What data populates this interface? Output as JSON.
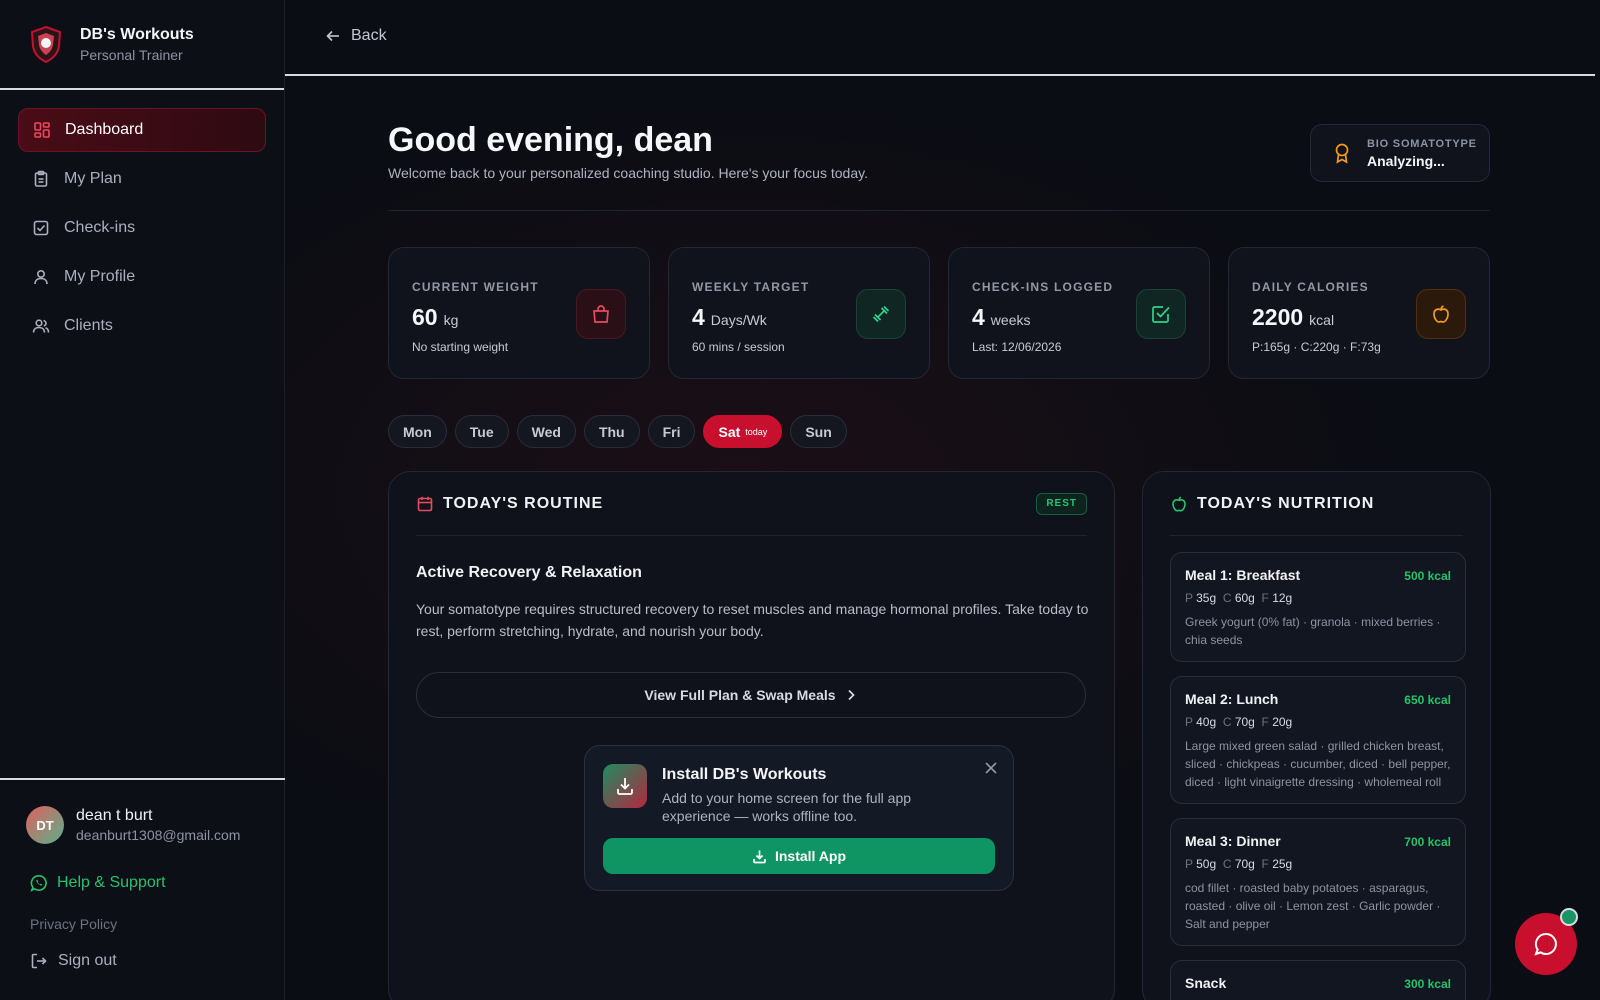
{
  "brand": {
    "title": "DB's Workouts",
    "subtitle": "Personal Trainer",
    "logo_icon": "shield-logo-icon"
  },
  "nav": {
    "items": [
      {
        "label": "Dashboard",
        "icon": "grid-icon",
        "active": true
      },
      {
        "label": "My Plan",
        "icon": "clipboard-icon"
      },
      {
        "label": "Check-ins",
        "icon": "check-square-icon"
      },
      {
        "label": "My Profile",
        "icon": "user-icon"
      },
      {
        "label": "Clients",
        "icon": "users-icon"
      }
    ]
  },
  "user": {
    "initials": "DT",
    "name": "dean t burt",
    "email": "deanburt1308@gmail.com"
  },
  "sidebar_footer": {
    "help": "Help & Support",
    "privacy": "Privacy Policy",
    "signout": "Sign out"
  },
  "topbar": {
    "back": "Back"
  },
  "greeting": {
    "title": "Good evening, dean",
    "subtitle": "Welcome back to your personalized coaching studio. Here's your focus today."
  },
  "bio": {
    "label": "BIO SOMATOTYPE",
    "value": "Analyzing..."
  },
  "stats": [
    {
      "label": "CURRENT WEIGHT",
      "value": "60",
      "unit": "kg",
      "sub": "No starting weight",
      "icon": "bag-icon",
      "color": "#e84a5f"
    },
    {
      "label": "WEEKLY TARGET",
      "value": "4",
      "unit": "Days/Wk",
      "sub": "60 mins / session",
      "icon": "dumbbell-icon",
      "color": "#2ed48a"
    },
    {
      "label": "CHECK-INS LOGGED",
      "value": "4",
      "unit": "weeks",
      "sub": "Last: 12/06/2026",
      "icon": "check-square-icon",
      "color": "#2ed48a"
    },
    {
      "label": "DAILY CALORIES",
      "value": "2200",
      "unit": "kcal",
      "sub": "P:165g · C:220g · F:73g",
      "icon": "apple-icon",
      "color": "#f39a1f"
    }
  ],
  "days": [
    {
      "label": "Mon"
    },
    {
      "label": "Tue"
    },
    {
      "label": "Wed"
    },
    {
      "label": "Thu"
    },
    {
      "label": "Fri"
    },
    {
      "label": "Sat",
      "tag": "today",
      "active": true
    },
    {
      "label": "Sun"
    }
  ],
  "routine": {
    "title": "TODAY'S ROUTINE",
    "badge": "REST",
    "heading": "Active Recovery & Relaxation",
    "description": "Your somatotype requires structured recovery to reset muscles and manage hormonal profiles. Take today to rest, perform stretching, hydrate, and nourish your body.",
    "plan_button": "View Full Plan & Swap Meals"
  },
  "install": {
    "title": "Install DB's Workouts",
    "description": "Add to your home screen for the full app experience — works offline too.",
    "button": "Install App"
  },
  "nutrition": {
    "title": "TODAY'S NUTRITION",
    "meals": [
      {
        "name": "Meal 1: Breakfast",
        "kcal": "500 kcal",
        "p": "35g",
        "c": "60g",
        "f": "12g",
        "items": "Greek yogurt (0% fat) · granola · mixed berries · chia seeds"
      },
      {
        "name": "Meal 2: Lunch",
        "kcal": "650 kcal",
        "p": "40g",
        "c": "70g",
        "f": "20g",
        "items": "Large mixed green salad · grilled chicken breast, sliced · chickpeas · cucumber, diced · bell pepper, diced · light vinaigrette dressing · wholemeal roll"
      },
      {
        "name": "Meal 3: Dinner",
        "kcal": "700 kcal",
        "p": "50g",
        "c": "70g",
        "f": "25g",
        "items": "cod fillet · roasted baby potatoes · asparagus, roasted · olive oil · Lemon zest · Garlic powder · Salt and pepper"
      },
      {
        "name": "Snack",
        "kcal": "300 kcal"
      }
    ]
  },
  "colors": {
    "accent": "#c8102e",
    "green": "#26c36b",
    "background": "#0b0d14"
  }
}
